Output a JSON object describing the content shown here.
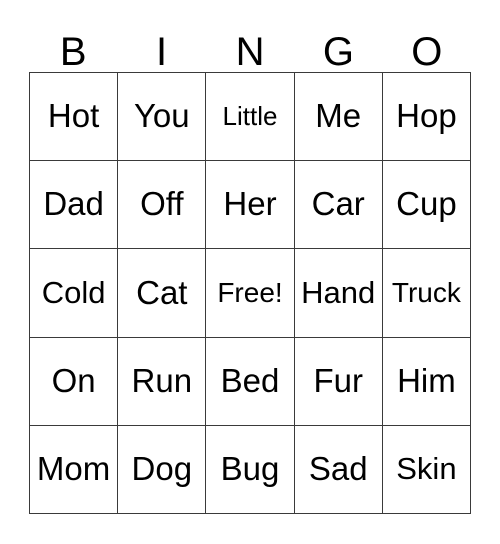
{
  "card": {
    "title": "BINGO",
    "headers": [
      "B",
      "I",
      "N",
      "G",
      "O"
    ],
    "free_space_label": "Free!",
    "colors": {
      "background": "#ffffff",
      "text": "#000000",
      "border": "#3a3a3a"
    },
    "rows": [
      [
        "Hot",
        "You",
        "Little",
        "Me",
        "Hop"
      ],
      [
        "Dad",
        "Off",
        "Her",
        "Car",
        "Cup"
      ],
      [
        "Cold",
        "Cat",
        "Free!",
        "Hand",
        "Truck"
      ],
      [
        "On",
        "Run",
        "Bed",
        "Fur",
        "Him"
      ],
      [
        "Mom",
        "Dog",
        "Bug",
        "Sad",
        "Skin"
      ]
    ]
  }
}
